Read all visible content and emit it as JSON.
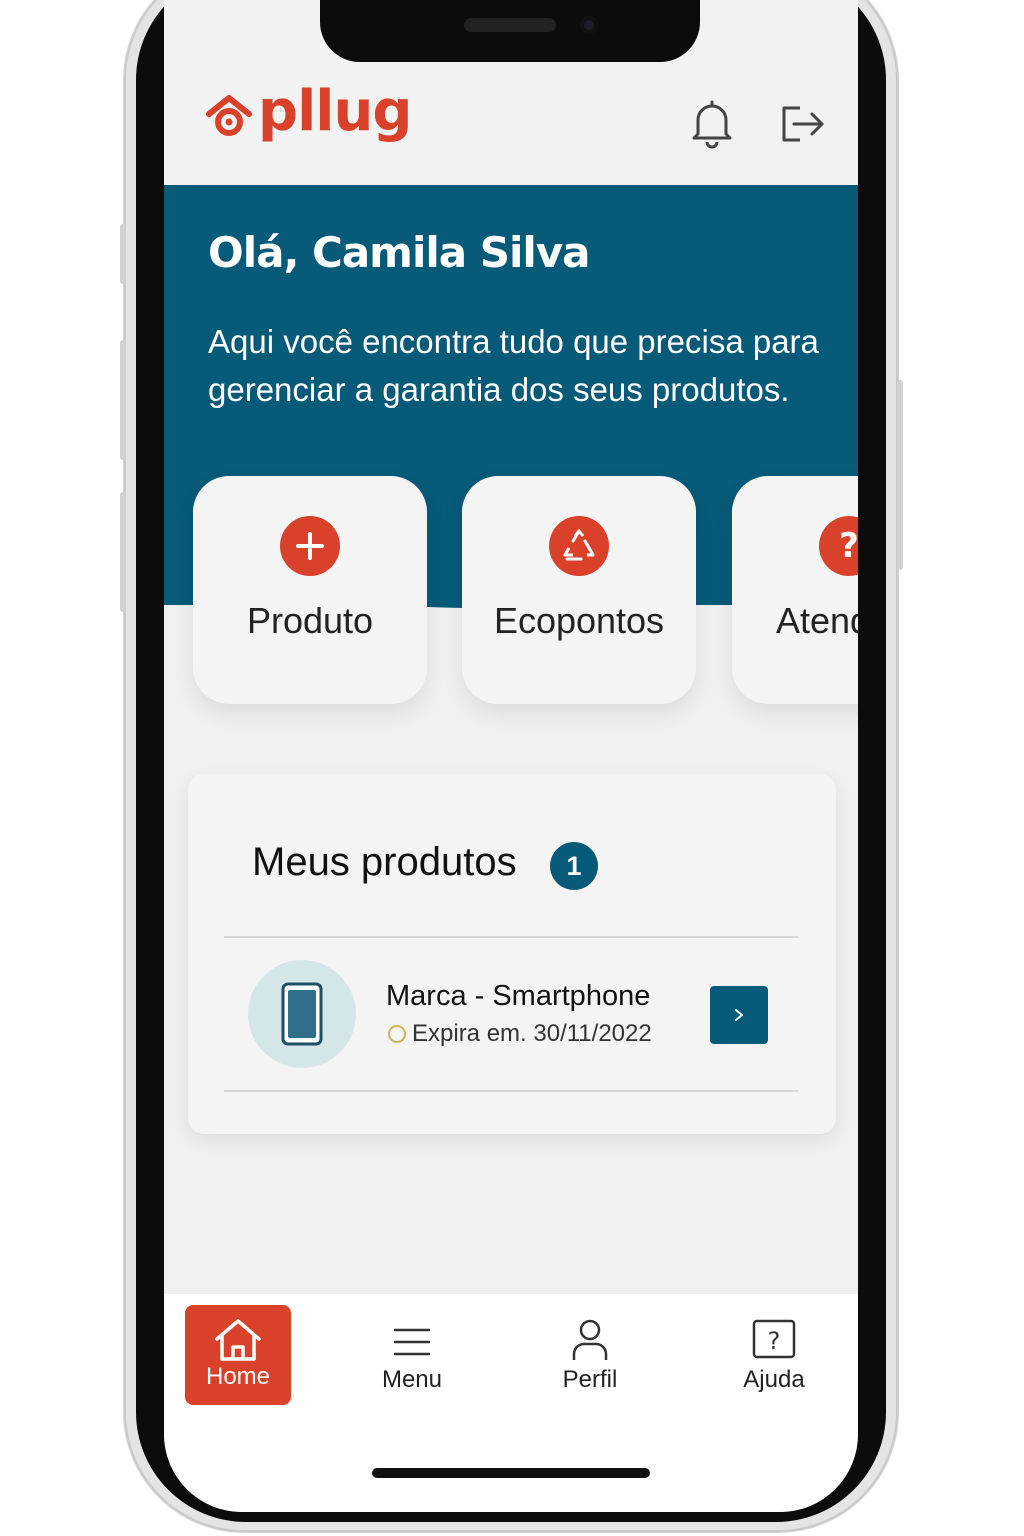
{
  "app": {
    "logo_text": "pllug",
    "brand_color": "#d9412b",
    "primary_color": "#075a78"
  },
  "header": {
    "notification_icon": "bell-icon",
    "logout_icon": "logout-icon"
  },
  "hero": {
    "greeting": "Olá, Camila Silva",
    "description_line1": "Aqui você encontra tudo que precisa para",
    "description_line2": "gerenciar a garantia dos seus produtos."
  },
  "quick_actions": [
    {
      "label": "Produto",
      "icon": "plus-icon"
    },
    {
      "label": "Ecopontos",
      "icon": "recycle-icon"
    },
    {
      "label": "Atend",
      "icon": "question-icon"
    }
  ],
  "products": {
    "title": "Meus produtos",
    "count": "1",
    "items": [
      {
        "name": "Marca - Smartphone",
        "expiry": "Expira em. 30/11/2022",
        "icon": "smartphone-icon"
      }
    ]
  },
  "tabbar": [
    {
      "label": "Home",
      "icon": "home-icon",
      "active": true
    },
    {
      "label": "Menu",
      "icon": "menu-icon",
      "active": false
    },
    {
      "label": "Perfil",
      "icon": "user-icon",
      "active": false
    },
    {
      "label": "Ajuda",
      "icon": "help-icon",
      "active": false
    }
  ]
}
